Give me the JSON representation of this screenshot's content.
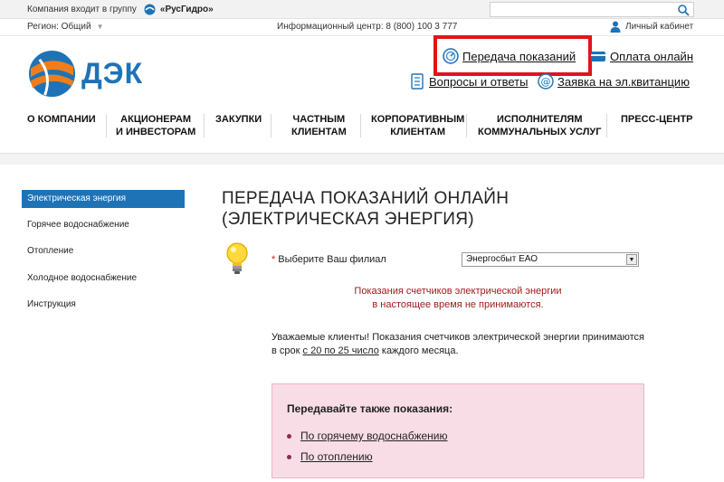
{
  "topbar": {
    "group_text": "Компания входит в группу",
    "group_brand": "«РусГидро»",
    "search_placeholder": ""
  },
  "infobar": {
    "region": "Регион: Общий",
    "info_center": "Информационный центр: 8 (800) 100 3 777",
    "cabinet": "Личный кабинет"
  },
  "logo": {
    "text": "ДЭК"
  },
  "header_links": {
    "transfer": "Передача показаний",
    "pay": "Оплата онлайн",
    "faq": "Вопросы и ответы",
    "receipt": "Заявка на эл.квитанцию"
  },
  "nav": {
    "about": "О КОМПАНИИ",
    "investors_1": "АКЦИОНЕРАМ",
    "investors_2": "И ИНВЕСТОРАМ",
    "purchases": "ЗАКУПКИ",
    "private_1": "ЧАСТНЫМ",
    "private_2": "КЛИЕНТАМ",
    "corporate_1": "КОРПОРАТИВНЫМ",
    "corporate_2": "КЛИЕНТАМ",
    "utilities_1": "ИСПОЛНИТЕЛЯМ",
    "utilities_2": "КОММУНАЛЬНЫХ УСЛУГ",
    "press": "ПРЕСС-ЦЕНТР"
  },
  "sidebar": {
    "items": [
      {
        "label": "Электрическая энергия",
        "active": true
      },
      {
        "label": "Горячее водоснабжение",
        "active": false
      },
      {
        "label": "Отопление",
        "active": false
      },
      {
        "label": "Холодное водоснабжение",
        "active": false
      },
      {
        "label": "Инструкция",
        "active": false
      }
    ]
  },
  "content": {
    "title_line1": "ПЕРЕДАЧА ПОКАЗАНИЙ ОНЛАЙН",
    "title_line2": "(ЭЛЕКТРИЧЕСКАЯ ЭНЕРГИЯ)",
    "required_mark": "*",
    "filial_label": "Выберите Ваш филиал",
    "filial_value": "Энергосбыт ЕАО",
    "notice_line1": "Показания счетчиков электрической энергии",
    "notice_line2": "в настоящее время не принимаются.",
    "para_part1": "Уважаемые клиенты! Показания счетчиков электрической энергии принимаются в срок ",
    "para_link": "с 20 по 25 число",
    "para_part2": " каждого месяца."
  },
  "also": {
    "title": "Передавайте также показания:",
    "link1": "По горячему водоснабжению",
    "link2": "По отоплению"
  },
  "colors": {
    "brand_blue": "#1e73b7",
    "brand_orange": "#f07d1a",
    "highlight_red": "#e0141b",
    "notice_red": "#a01c1c",
    "pink_box": "#f8dde6"
  }
}
